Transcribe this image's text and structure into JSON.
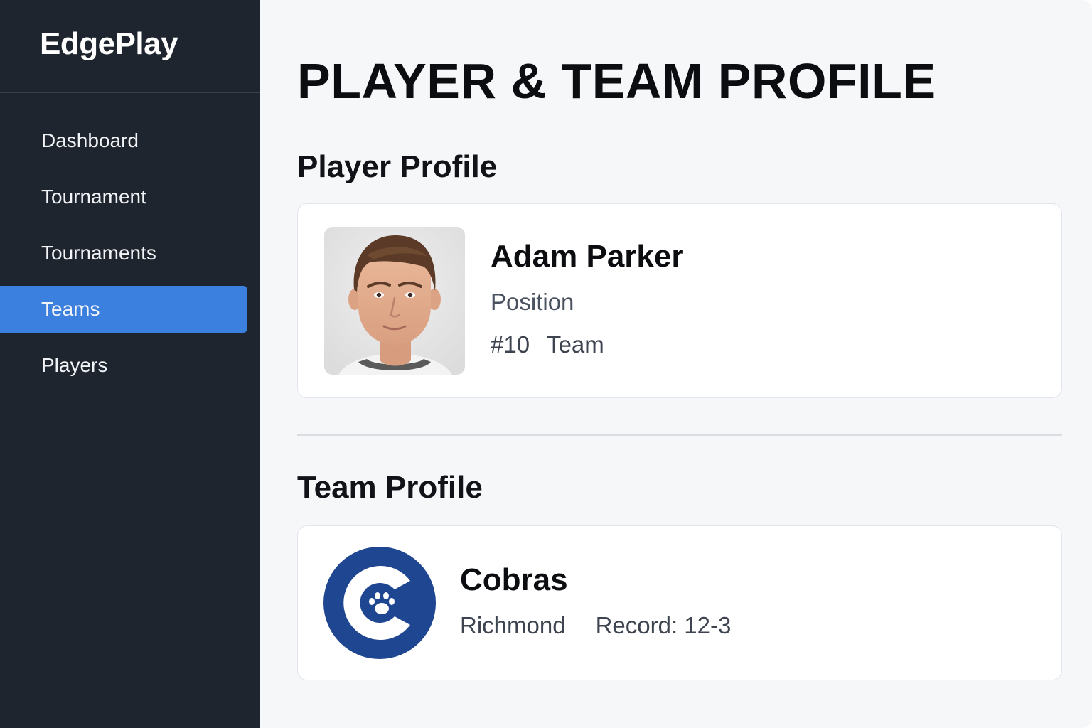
{
  "brand": {
    "name": "EdgePlay"
  },
  "sidebar": {
    "items": [
      {
        "label": "Dashboard",
        "active": false
      },
      {
        "label": "Tournament",
        "active": false
      },
      {
        "label": "Tournaments",
        "active": false
      },
      {
        "label": "Teams",
        "active": true
      },
      {
        "label": "Players",
        "active": false
      }
    ]
  },
  "page": {
    "title": "PLAYER & TEAM PROFILE"
  },
  "player_section": {
    "title": "Player Profile",
    "name": "Adam Parker",
    "position": "Position",
    "number": "#10",
    "team": "Team"
  },
  "team_section": {
    "title": "Team Profile",
    "name": "Cobras",
    "city": "Richmond",
    "record": "Record: 12-3"
  },
  "colors": {
    "sidebar_bg": "#1f252e",
    "active_nav": "#3b7fdf",
    "team_logo": "#1f4690",
    "page_bg": "#f6f7f9"
  },
  "icons": {
    "team_logo": "paw-icon"
  }
}
